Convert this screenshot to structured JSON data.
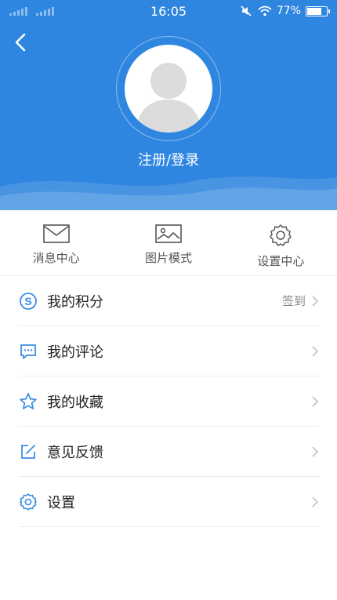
{
  "status_bar": {
    "time": "16:05",
    "battery_percent": "77%",
    "battery_level": 0.77
  },
  "header": {
    "login_text": "注册/登录",
    "background_color": "#2f86e0"
  },
  "quick_actions": [
    {
      "label": "消息中心",
      "icon": "mail-icon"
    },
    {
      "label": "图片模式",
      "icon": "image-icon"
    },
    {
      "label": "设置中心",
      "icon": "gear-icon"
    }
  ],
  "menu": {
    "items": [
      {
        "label": "我的积分",
        "icon": "points-icon",
        "extra": "签到"
      },
      {
        "label": "我的评论",
        "icon": "comment-icon",
        "extra": ""
      },
      {
        "label": "我的收藏",
        "icon": "star-icon",
        "extra": ""
      },
      {
        "label": "意见反馈",
        "icon": "feedback-icon",
        "extra": ""
      },
      {
        "label": "设置",
        "icon": "settings-icon",
        "extra": ""
      }
    ]
  },
  "colors": {
    "accent": "#2f86e0",
    "icon_blue": "#3a8ee6",
    "divider": "#ededed"
  }
}
